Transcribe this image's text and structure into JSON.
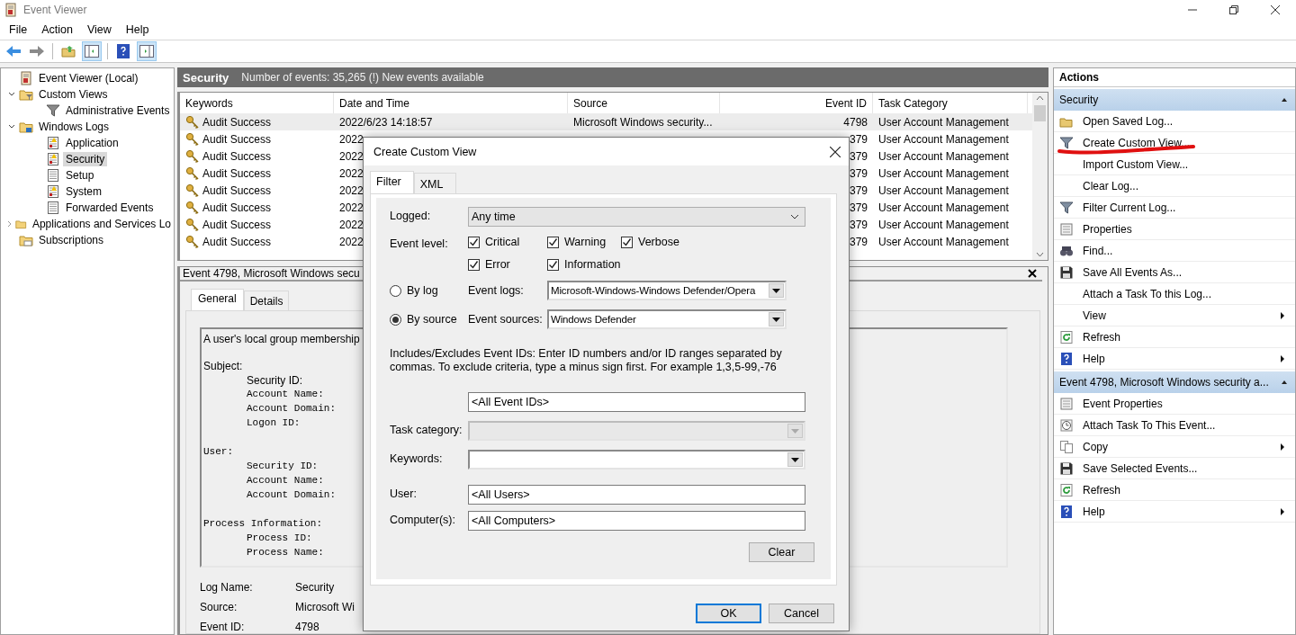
{
  "window": {
    "title": "Event Viewer"
  },
  "menu": [
    "File",
    "Action",
    "View",
    "Help"
  ],
  "tree": [
    {
      "label": "Event Viewer (Local)",
      "kind": "root",
      "selected": false
    },
    {
      "label": "Custom Views",
      "kind": "filterfolder",
      "selected": false,
      "expanded": true,
      "children": [
        {
          "label": "Administrative Events",
          "kind": "filter",
          "selected": false
        }
      ]
    },
    {
      "label": "Windows Logs",
      "kind": "logfolder",
      "selected": false,
      "expanded": true,
      "children": [
        {
          "label": "Application",
          "kind": "log",
          "selected": false
        },
        {
          "label": "Security",
          "kind": "securitylog",
          "selected": true
        },
        {
          "label": "Setup",
          "kind": "plainlog",
          "selected": false
        },
        {
          "label": "System",
          "kind": "log",
          "selected": false
        },
        {
          "label": "Forwarded Events",
          "kind": "plainlog",
          "selected": false
        }
      ]
    },
    {
      "label": "Applications and Services Lo",
      "kind": "folder",
      "selected": false,
      "expanded": false
    },
    {
      "label": "Subscriptions",
      "kind": "subfolder",
      "selected": false
    }
  ],
  "log": {
    "title": "Security",
    "summary": "Number of events: 35,265 (!) New events available",
    "columns": [
      "Keywords",
      "Date and Time",
      "Source",
      "Event ID",
      "Task Category"
    ],
    "rows": [
      {
        "keywords": "Audit Success",
        "date": "2022/6/23 14:18:57",
        "source": "Microsoft Windows security...",
        "event_id": "4798",
        "task": "User Account Management",
        "selected": true
      },
      {
        "keywords": "Audit Success",
        "date": "2022",
        "event_id": "379",
        "task": "User Account Management",
        "selected": false
      },
      {
        "keywords": "Audit Success",
        "date": "2022",
        "event_id": "379",
        "task": "User Account Management",
        "selected": false
      },
      {
        "keywords": "Audit Success",
        "date": "2022",
        "event_id": "379",
        "task": "User Account Management",
        "selected": false
      },
      {
        "keywords": "Audit Success",
        "date": "2022",
        "event_id": "379",
        "task": "User Account Management",
        "selected": false
      },
      {
        "keywords": "Audit Success",
        "date": "2022",
        "event_id": "379",
        "task": "User Account Management",
        "selected": false
      },
      {
        "keywords": "Audit Success",
        "date": "2022",
        "event_id": "379",
        "task": "User Account Management",
        "selected": false
      },
      {
        "keywords": "Audit Success",
        "date": "2022",
        "event_id": "379",
        "task": "User Account Management",
        "selected": false
      }
    ]
  },
  "detail": {
    "title": "Event 4798, Microsoft Windows secu",
    "tabs": [
      {
        "label": "General",
        "selected": true
      },
      {
        "label": "Details",
        "selected": false
      }
    ],
    "intro": "A user's local group membership",
    "sections": [
      {
        "heading": "Subject:",
        "fields": [
          "Security ID:",
          "Account Name:",
          "Account Domain:",
          "Logon ID:"
        ]
      },
      {
        "heading": "User:",
        "fields": [
          "Security ID:",
          "Account Name:",
          "Account Domain:"
        ]
      },
      {
        "heading": "Process Information:",
        "fields": [
          "Process ID:",
          "Process Name:"
        ]
      }
    ],
    "properties": [
      {
        "label": "Log Name:",
        "value": "Security"
      },
      {
        "label": "Source:",
        "value": "Microsoft Wi"
      },
      {
        "label": "Event ID:",
        "value": "4798"
      }
    ]
  },
  "actions": {
    "title": "Actions",
    "groups": [
      {
        "title": "Security",
        "expanded": true,
        "items": [
          {
            "label": "Open Saved Log...",
            "kind": "open",
            "submenu": false
          },
          {
            "label": "Create Custom View...",
            "kind": "funnel",
            "submenu": false
          },
          {
            "label": "Import Custom View...",
            "kind": "none",
            "submenu": false
          },
          {
            "label": "Clear Log...",
            "kind": "none",
            "submenu": false
          },
          {
            "label": "Filter Current Log...",
            "kind": "funnel",
            "submenu": false
          },
          {
            "label": "Properties",
            "kind": "properties",
            "submenu": false
          },
          {
            "label": "Find...",
            "kind": "find",
            "submenu": false
          },
          {
            "label": "Save All Events As...",
            "kind": "save",
            "submenu": false
          },
          {
            "label": "Attach a Task To this Log...",
            "kind": "none",
            "submenu": false
          },
          {
            "label": "View",
            "kind": "none",
            "submenu": true
          },
          {
            "label": "Refresh",
            "kind": "refresh",
            "submenu": false
          },
          {
            "label": "Help",
            "kind": "help",
            "submenu": true
          }
        ]
      },
      {
        "title": "Event 4798, Microsoft Windows security a...",
        "expanded": true,
        "items": [
          {
            "label": "Event Properties",
            "kind": "properties",
            "submenu": false
          },
          {
            "label": "Attach Task To This Event...",
            "kind": "task",
            "submenu": false
          },
          {
            "label": "Copy",
            "kind": "copy",
            "submenu": true
          },
          {
            "label": "Save Selected Events...",
            "kind": "save",
            "submenu": false
          },
          {
            "label": "Refresh",
            "kind": "refresh",
            "submenu": false
          },
          {
            "label": "Help",
            "kind": "help",
            "submenu": true
          }
        ]
      }
    ]
  },
  "dialog": {
    "title": "Create Custom View",
    "tabs": [
      {
        "label": "Filter",
        "selected": true
      },
      {
        "label": "XML",
        "selected": false
      }
    ],
    "logged": {
      "label": "Logged:",
      "value": "Any time"
    },
    "event_level": {
      "label": "Event level:",
      "levels": [
        {
          "label": "Critical",
          "checked": true
        },
        {
          "label": "Warning",
          "checked": true
        },
        {
          "label": "Verbose",
          "checked": true
        },
        {
          "label": "Error",
          "checked": true
        },
        {
          "label": "Information",
          "checked": true
        }
      ]
    },
    "sources": [
      {
        "option": "By log",
        "selected": false,
        "label": "Event logs:",
        "value": "Microsoft-Windows-Windows Defender/Opera"
      },
      {
        "option": "By source",
        "selected": true,
        "label": "Event sources:",
        "value": "Windows Defender"
      }
    ],
    "help": "Includes/Excludes Event IDs: Enter ID numbers and/or ID ranges separated by commas. To exclude criteria, type a minus sign first. For example 1,3,5-99,-76",
    "event_ids": {
      "value": "<All Event IDs>"
    },
    "fields": [
      {
        "label": "Task category:",
        "kind": "combo",
        "disabled": true
      },
      {
        "label": "Keywords:",
        "kind": "combo",
        "disabled": false
      },
      {
        "label": "User:",
        "kind": "text",
        "value": "<All Users>",
        "disabled": false
      },
      {
        "label": "Computer(s):",
        "kind": "text",
        "value": "<All Computers>",
        "disabled": false
      }
    ],
    "clear": "Clear",
    "buttons": [
      {
        "label": "OK",
        "default": true
      },
      {
        "label": "Cancel",
        "default": false
      }
    ]
  }
}
